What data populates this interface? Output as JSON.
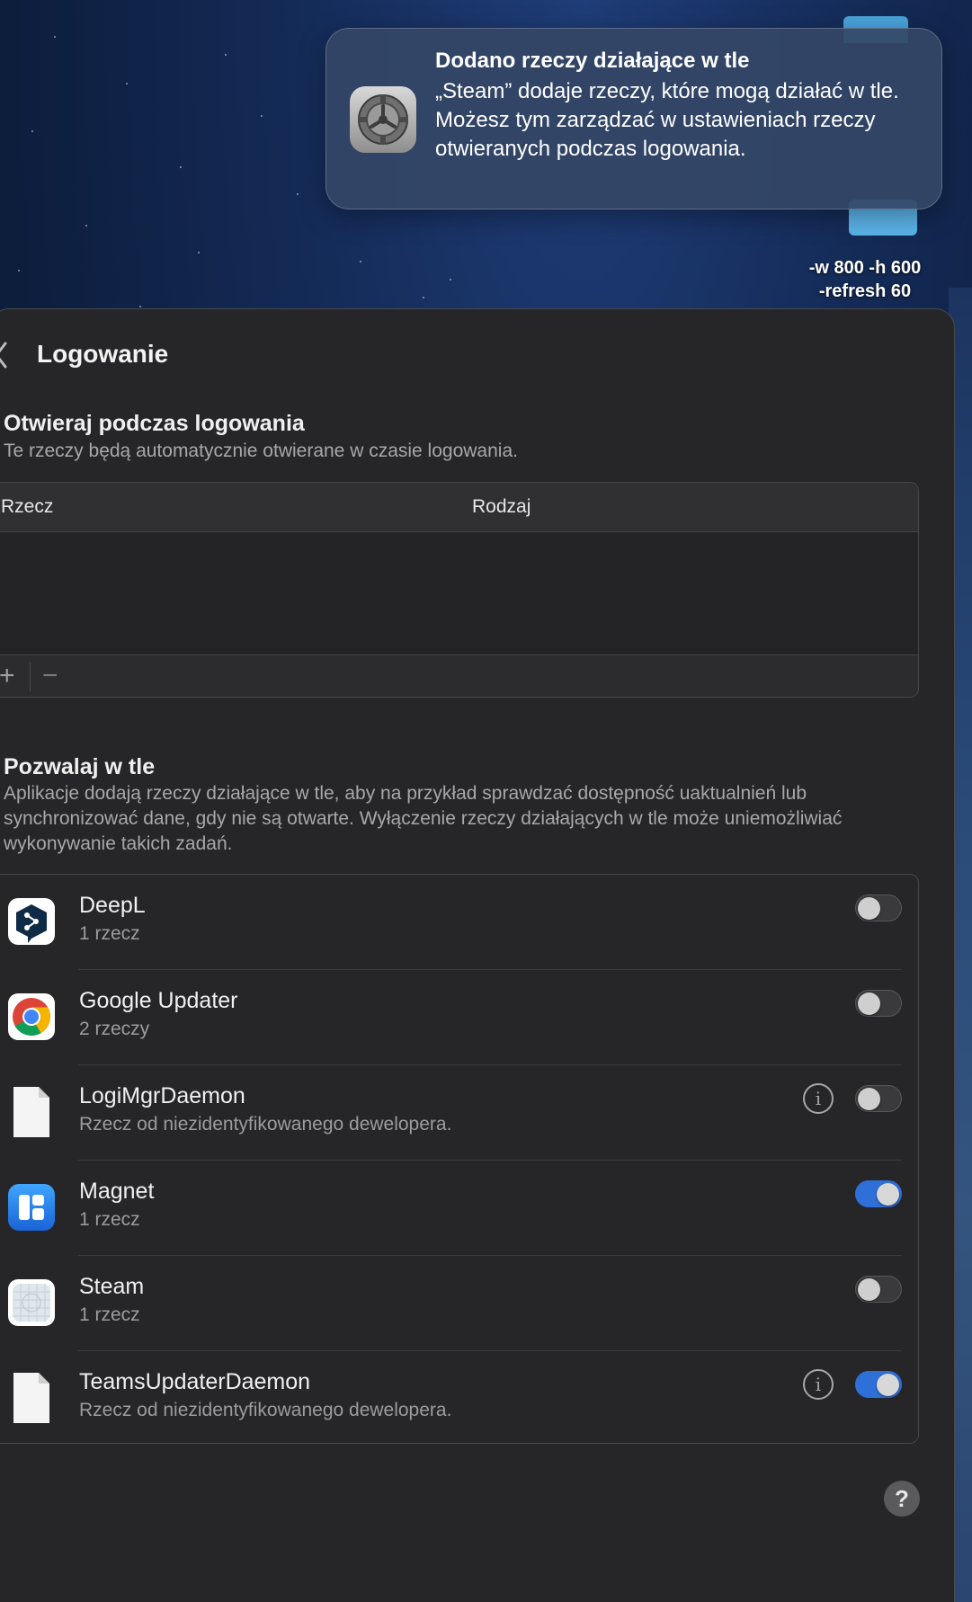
{
  "notification": {
    "title": "Dodano rzeczy działające w tle",
    "body": "„Steam” dodaje rzeczy, które mogą działać w tle. Możesz tym zarządzać w ustawieniach rzeczy otwieranych podczas logowania.",
    "icon": "gear-icon"
  },
  "desktop": {
    "label_line1": "-w 800 -h 600",
    "label_line2": "-refresh 60"
  },
  "window": {
    "title": "Logowanie",
    "open_at_login": {
      "title": "Otwieraj podczas logowania",
      "subtitle": "Te rzeczy będą automatycznie otwierane w czasie logowania.",
      "columns": [
        "Rzecz",
        "Rodzaj"
      ],
      "add_label": "+",
      "remove_label": "−"
    },
    "allow_background": {
      "title": "Pozwalaj w tle",
      "subtitle": "Aplikacje dodają rzeczy działające w tle, aby na przykład sprawdzać dostępność uaktualnień lub synchronizować dane, gdy nie są otwarte. Wyłączenie rzeczy działających w tle może uniemożliwiać wykonywanie takich zadań.",
      "items": [
        {
          "name": "DeepL",
          "sub": "1 rzecz",
          "icon": "deepl-icon",
          "info": false,
          "enabled": false
        },
        {
          "name": "Google Updater",
          "sub": "2 rzeczy",
          "icon": "chrome-icon",
          "info": false,
          "enabled": false
        },
        {
          "name": "LogiMgrDaemon",
          "sub": "Rzecz od niezidentyfikowanego dewelopera.",
          "icon": "document-icon",
          "info": true,
          "enabled": false
        },
        {
          "name": "Magnet",
          "sub": "1 rzecz",
          "icon": "magnet-icon",
          "info": false,
          "enabled": true
        },
        {
          "name": "Steam",
          "sub": "1 rzecz",
          "icon": "steam-icon",
          "info": false,
          "enabled": false
        },
        {
          "name": "TeamsUpdaterDaemon",
          "sub": "Rzecz od niezidentyfikowanego dewelopera.",
          "icon": "document-icon",
          "info": true,
          "enabled": true
        }
      ]
    },
    "help_label": "?"
  },
  "colors": {
    "toggle_on": "#2f6fd8",
    "window_bg": "#262628",
    "desktop_bg": "#142b57"
  }
}
